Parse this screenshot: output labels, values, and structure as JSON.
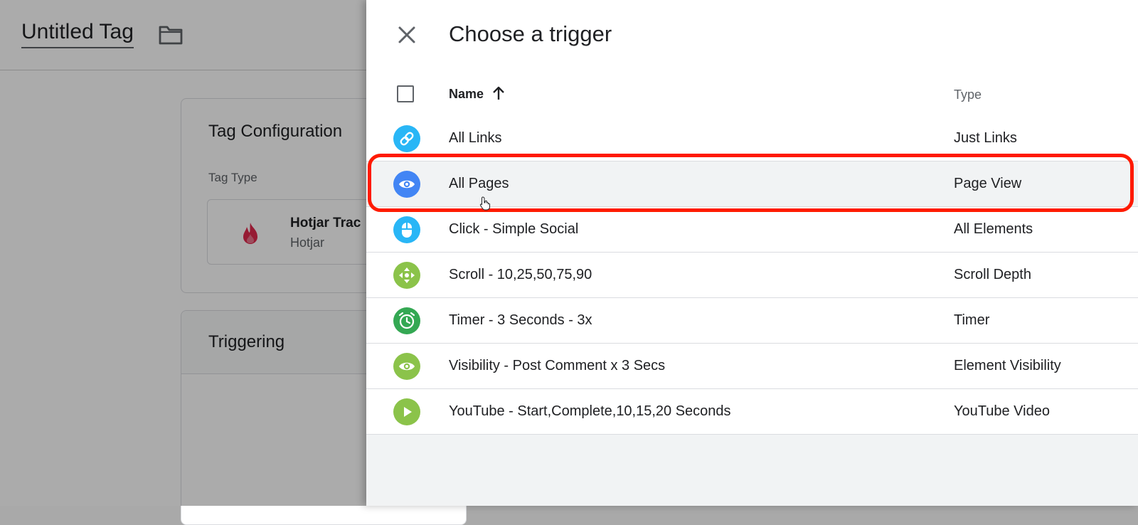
{
  "tag_editor": {
    "title": "Untitled Tag",
    "tag_configuration": {
      "title": "Tag Configuration",
      "tag_type_label": "Tag Type",
      "tag_type_name": "Hotjar Trac",
      "tag_type_vendor": "Hotjar"
    },
    "triggering": {
      "title": "Triggering"
    }
  },
  "panel": {
    "title": "Choose a trigger",
    "columns": {
      "name": "Name",
      "type": "Type"
    },
    "sort": "ascending",
    "rows": [
      {
        "name": "All Links",
        "type": "Just Links",
        "icon": "link-icon",
        "color": "#29b6f6"
      },
      {
        "name": "All Pages",
        "type": "Page View",
        "icon": "eye-icon",
        "color": "#4285f4",
        "highlighted": true
      },
      {
        "name": "Click - Simple Social",
        "type": "All Elements",
        "icon": "mouse-icon",
        "color": "#29b6f6"
      },
      {
        "name": "Scroll - 10,25,50,75,90",
        "type": "Scroll Depth",
        "icon": "move-arrows-icon",
        "color": "#8bc34a"
      },
      {
        "name": "Timer - 3 Seconds - 3x",
        "type": "Timer",
        "icon": "alarm-clock-icon",
        "color": "#34a853"
      },
      {
        "name": "Visibility - Post Comment x 3 Secs",
        "type": "Element Visibility",
        "icon": "eye-icon",
        "color": "#8bc34a"
      },
      {
        "name": "YouTube - Start,Complete,10,15,20 Seconds",
        "type": "YouTube Video",
        "icon": "play-icon",
        "color": "#8bc34a"
      }
    ]
  },
  "colors": {
    "highlight": "#ff1a00",
    "hotjar": "#e0294d"
  }
}
